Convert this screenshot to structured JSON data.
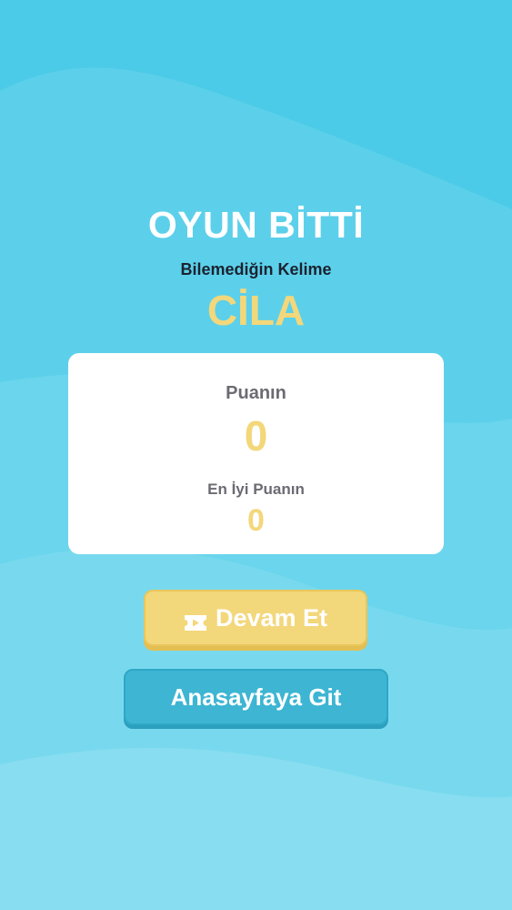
{
  "game_over": {
    "title": "OYUN BİTTİ",
    "subtitle": "Bilemediğin Kelime",
    "word": "CİLA"
  },
  "score_card": {
    "score_label": "Puanın",
    "score_value": "0",
    "best_label": "En İyi Puanın",
    "best_value": "0"
  },
  "buttons": {
    "continue_label": "Devam Et",
    "continue_icon": "ticket-video-icon",
    "home_label": "Anasayfaya Git"
  },
  "colors": {
    "background": "#4ccbe8",
    "accent_yellow": "#f3d77b",
    "button_blue": "#3db5d3",
    "card_white": "#ffffff"
  }
}
